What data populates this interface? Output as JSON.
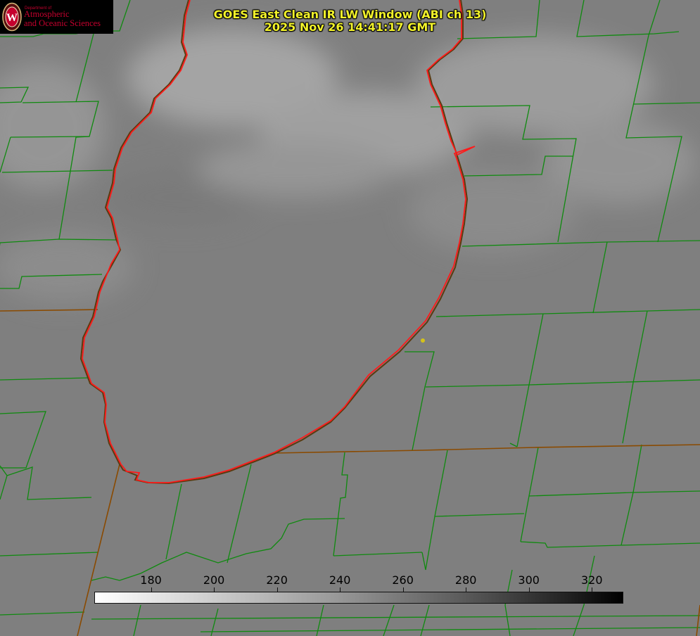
{
  "logo": {
    "department_label": "Department of",
    "line1": "Atmospheric",
    "line2": "and Oceanic Sciences",
    "seal_letter": "W",
    "brand_color": "#c5002e"
  },
  "header": {
    "title": "GOES East Clean IR LW Window (ABI ch 13)",
    "timestamp": "2025 Nov 26 14:41:17 GMT"
  },
  "colors": {
    "lake_outline": "#ff1a1a",
    "county_lines": "#0f8a0f",
    "state_lines": "#8a4a00",
    "title_text": "#f2f22a",
    "marker": "#d4c21a"
  },
  "colorbar": {
    "ticks": [
      "180",
      "200",
      "220",
      "240",
      "260",
      "280",
      "300",
      "320"
    ],
    "range": [
      162,
      330
    ],
    "gradient_direction": "white-to-black"
  }
}
